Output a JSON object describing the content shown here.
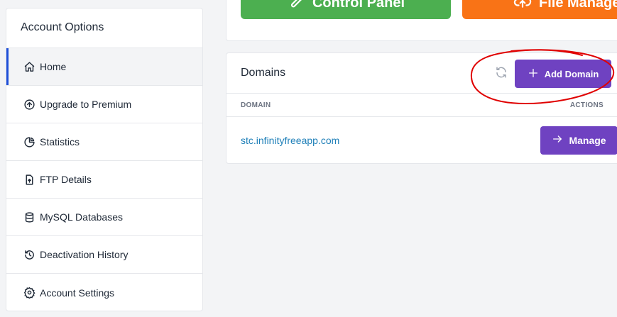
{
  "sidebar": {
    "title": "Account Options",
    "items": [
      {
        "label": "Home",
        "icon": "home-icon",
        "active": true
      },
      {
        "label": "Upgrade to Premium",
        "icon": "arrow-up-circle-icon"
      },
      {
        "label": "Statistics",
        "icon": "pie-chart-icon"
      },
      {
        "label": "FTP Details",
        "icon": "file-upload-icon"
      },
      {
        "label": "MySQL Databases",
        "icon": "database-icon"
      },
      {
        "label": "Deactivation History",
        "icon": "history-icon"
      },
      {
        "label": "Account Settings",
        "icon": "gear-icon"
      }
    ]
  },
  "tiles": {
    "control_panel": "Control Panel",
    "file_manager": "File Manager"
  },
  "domains": {
    "title": "Domains",
    "add_label": "Add Domain",
    "columns": {
      "domain": "DOMAIN",
      "actions": "ACTIONS"
    },
    "rows": [
      {
        "domain": "stc.infinityfreeapp.com",
        "action": "Manage"
      }
    ]
  },
  "colors": {
    "accent_purple": "#6f42c1",
    "tile_green": "#4caf50",
    "tile_orange": "#f97316",
    "link_blue": "#1e7fb8",
    "annotation_red": "#e00000"
  }
}
